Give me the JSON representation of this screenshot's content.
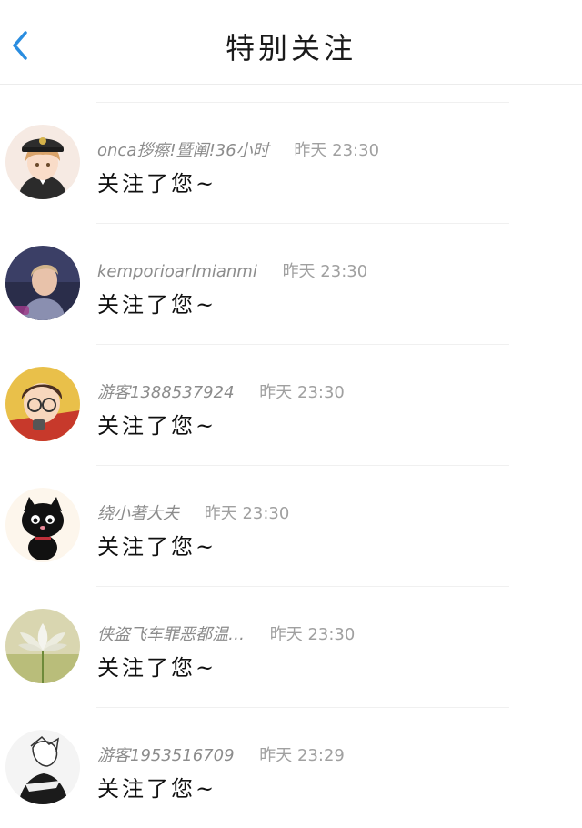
{
  "header": {
    "title": "特别关注",
    "back_icon": "chevron-left-icon",
    "back_color": "#2a8de0"
  },
  "items": [
    {
      "name": "onca拶瘵!暨阐!36小时",
      "time": "昨天 23:30",
      "message": "关注了您~",
      "avatar": "anime-boy-captain-hat-avatar"
    },
    {
      "name": "kemporioarlmianmi",
      "time": "昨天 23:30",
      "message": "关注了您~",
      "avatar": "young-man-photo-avatar"
    },
    {
      "name": "游客1388537924",
      "time": "昨天 23:30",
      "message": "关注了您~",
      "avatar": "anime-detective-avatar"
    },
    {
      "name": "绕小著大夫",
      "time": "昨天 23:30",
      "message": "关注了您~",
      "avatar": "black-cat-avatar"
    },
    {
      "name": "侠盗飞车罪恶都温…",
      "time": "昨天 23:30",
      "message": "关注了您~",
      "avatar": "white-lotus-avatar"
    },
    {
      "name": "游客1953516709",
      "time": "昨天 23:29",
      "message": "关注了您~",
      "avatar": "sketch-character-avatar"
    }
  ]
}
